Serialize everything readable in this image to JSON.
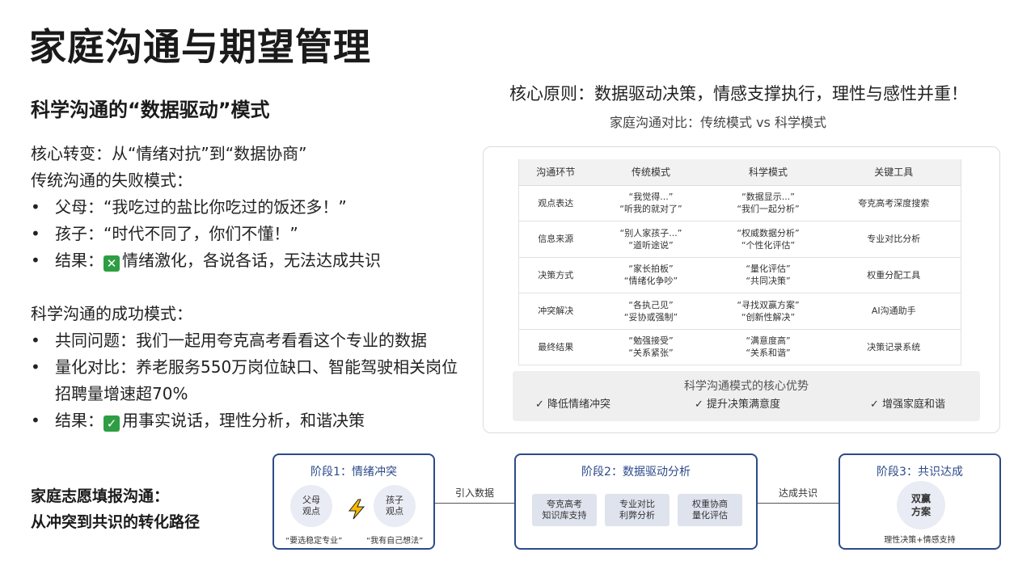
{
  "title": "家庭沟通与期望管理",
  "subtitle": "科学沟通的“数据驱动”模式",
  "left": {
    "core_shift": "核心转变：从“情绪对抗”到“数据协商”",
    "fail_heading": "传统沟通的失败模式：",
    "fail_items": [
      {
        "bullet": "•",
        "text": "父母：“我吃过的盐比你吃过的饭还多！”"
      },
      {
        "bullet": "•",
        "text": "孩子：“时代不同了，你们不懂！”"
      }
    ],
    "fail_result_label": "结果：",
    "fail_result_badge": "✕",
    "fail_result_text": "情绪激化，各说各话，无法达成共识",
    "success_heading": "科学沟通的成功模式：",
    "success_items": [
      {
        "bullet": "•",
        "text": "共同问题：我们一起用夸克高考看看这个专业的数据"
      },
      {
        "bullet": "•",
        "text": "量化对比：养老服务550万岗位缺口、智能驾驶相关岗位招聘量增速超70%"
      }
    ],
    "success_result_label": "结果：",
    "success_result_badge": "✓",
    "success_result_text": "用事实说话，理性分析，和谐决策",
    "bullet": "•"
  },
  "principle": "核心原则：数据驱动决策，情感支撑执行，理性与感性并重！",
  "compare_title": "家庭沟通对比：传统模式 vs 科学模式",
  "table": {
    "headers": [
      "沟通环节",
      "传统模式",
      "科学模式",
      "关键工具"
    ],
    "rows": [
      {
        "stage": "观点表达",
        "trad": [
          "“我觉得...”",
          "“听我的就对了”"
        ],
        "sci": [
          "“数据显示...”",
          "“我们一起分析”"
        ],
        "tool": "夸克高考深度搜索"
      },
      {
        "stage": "信息来源",
        "trad": [
          "“别人家孩子...”",
          "“道听途说”"
        ],
        "sci": [
          "“权威数据分析”",
          "“个性化评估”"
        ],
        "tool": "专业对比分析"
      },
      {
        "stage": "决策方式",
        "trad": [
          "“家长拍板”",
          "“情绪化争吵”"
        ],
        "sci": [
          "“量化评估”",
          "“共同决策”"
        ],
        "tool": "权重分配工具"
      },
      {
        "stage": "冲突解决",
        "trad": [
          "“各执己见”",
          "“妥协或强制”"
        ],
        "sci": [
          "“寻找双赢方案”",
          "“创新性解决”"
        ],
        "tool": "AI沟通助手"
      },
      {
        "stage": "最终结果",
        "trad": [
          "“勉强接受”",
          "“关系紧张”"
        ],
        "sci": [
          "“满意度高”",
          "“关系和谐”"
        ],
        "tool": "决策记录系统"
      }
    ]
  },
  "advantages": {
    "title": "科学沟通模式的核心优势",
    "items": [
      "✓ 降低情绪冲突",
      "✓ 提升决策满意度",
      "✓ 增强家庭和谐"
    ]
  },
  "bottom_title": [
    "家庭志愿填报沟通：",
    "从冲突到共识的转化路径"
  ],
  "stages": {
    "s1": {
      "title": "阶段1：情绪冲突",
      "parent": [
        "父母",
        "观点"
      ],
      "child": [
        "孩子",
        "观点"
      ],
      "parent_quote": "“要选稳定专业”",
      "child_quote": "“我有自己想法”"
    },
    "conn1": "引入数据",
    "s2": {
      "title": "阶段2：数据驱动分析",
      "tools": [
        [
          "夸克高考",
          "知识库支持"
        ],
        [
          "专业对比",
          "利弊分析"
        ],
        [
          "权重协商",
          "量化评估"
        ]
      ]
    },
    "conn2": "达成共识",
    "s3": {
      "title": "阶段3：共识达成",
      "circle": [
        "双赢",
        "方案"
      ],
      "caption": "理性决策+情感支持"
    }
  },
  "colors": {
    "accent": "#2c4a8a",
    "traditional": "#a8262a",
    "scientific": "#4a8a2a",
    "badge": "#2e9e44"
  }
}
